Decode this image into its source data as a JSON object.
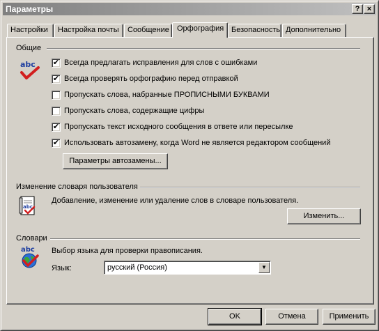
{
  "window": {
    "title": "Параметры",
    "help_label": "?",
    "close_label": "×"
  },
  "tabs": [
    {
      "label": "Настройки"
    },
    {
      "label": "Настройка почты"
    },
    {
      "label": "Сообщение"
    },
    {
      "label": "Орфография",
      "active": true
    },
    {
      "label": "Безопасность"
    },
    {
      "label": "Дополнительно"
    }
  ],
  "general": {
    "label": "Общие",
    "icon": "abc-spellcheck-icon",
    "options": [
      {
        "label": "Всегда предлагать исправления для слов с ошибками",
        "checked": true
      },
      {
        "label": "Всегда проверять орфографию перед отправкой",
        "checked": true
      },
      {
        "label": "Пропускать слова, набранные ПРОПИСНЫМИ БУКВАМИ",
        "checked": false
      },
      {
        "label": "Пропускать слова, содержащие цифры",
        "checked": false
      },
      {
        "label": "Пропускать текст исходного сообщения в ответе или пересылке",
        "checked": true
      },
      {
        "label": "Использовать автозамену, когда Word не является редактором сообщений",
        "checked": true
      }
    ],
    "autocorrect_button": "Параметры автозамены..."
  },
  "custom_dictionary": {
    "label": "Изменение словаря пользователя",
    "icon": "dictionary-document-icon",
    "description": "Добавление, изменение или удаление слов в словаре пользователя.",
    "edit_button": "Изменить..."
  },
  "dictionaries": {
    "label": "Словари",
    "icon": "abc-globe-icon",
    "description": "Выбор языка для проверки правописания.",
    "language_label": "Язык:",
    "language_value": "русский (Россия)"
  },
  "footer": {
    "ok": "OK",
    "cancel": "Отмена",
    "apply": "Применить"
  },
  "check_mark": "✔"
}
